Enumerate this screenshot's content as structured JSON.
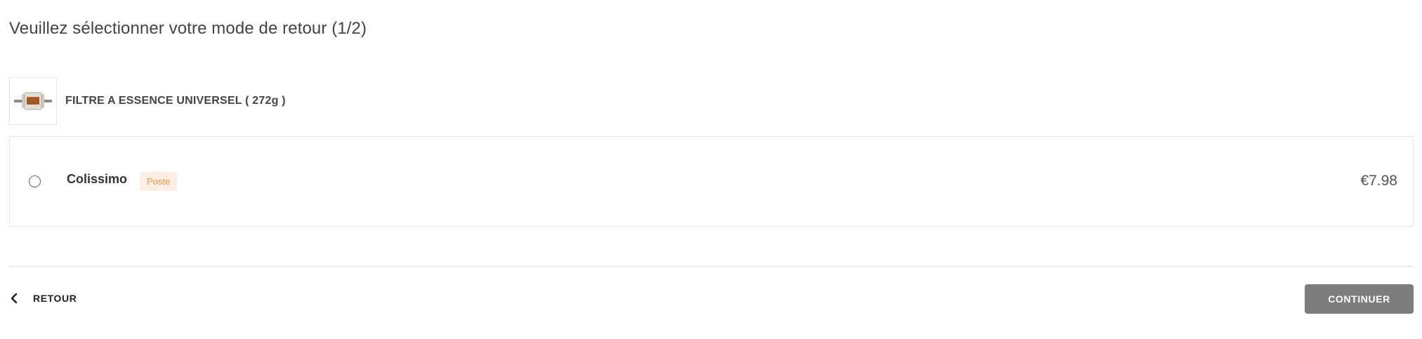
{
  "page": {
    "title": "Veuillez sélectionner votre mode de retour (1/2)"
  },
  "product": {
    "name": "FILTRE A ESSENCE UNIVERSEL  ( 272g )",
    "thumbnail_icon": "fuel-filter-icon"
  },
  "shipping_options": [
    {
      "carrier": "Colissimo",
      "badge": "Poste",
      "price": "€7.98",
      "selected": false
    }
  ],
  "footer": {
    "back_label": "RETOUR",
    "back_icon": "chevron-left-icon",
    "continue_label": "CONTINUER"
  },
  "colors": {
    "badge_bg": "#fdeee3",
    "badge_text": "#f2964f",
    "continue_bg": "#7d7d7d"
  }
}
